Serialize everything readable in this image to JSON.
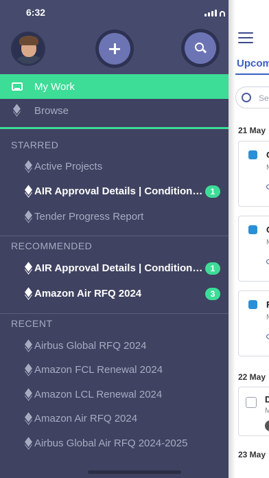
{
  "status_bar": {
    "time": "6:32"
  },
  "header": {
    "avatar_icon": "user-avatar",
    "add_icon": "plus-icon",
    "search_icon": "search-icon"
  },
  "nav": {
    "my_work": "My Work",
    "browse": "Browse"
  },
  "sections": {
    "starred": {
      "title": "STARRED",
      "items": [
        {
          "label": "Active Projects",
          "bold": false,
          "badge": null
        },
        {
          "label": "AIR Approval Details | Condition Check",
          "bold": true,
          "badge": "1"
        },
        {
          "label": "Tender Progress Report",
          "bold": false,
          "badge": null
        }
      ]
    },
    "recommended": {
      "title": "RECOMMENDED",
      "items": [
        {
          "label": "AIR Approval Details | Condition Check",
          "bold": true,
          "badge": "1"
        },
        {
          "label": "Amazon Air RFQ 2024",
          "bold": true,
          "badge": "3"
        }
      ]
    },
    "recent": {
      "title": "RECENT",
      "items": [
        {
          "label": "Airbus Global RFQ 2024"
        },
        {
          "label": "Amazon FCL Renewal 2024"
        },
        {
          "label": "Amazon LCL Renewal 2024"
        },
        {
          "label": "Amazon Air RFQ 2024"
        },
        {
          "label": "Airbus Global Air RFQ 2024-2025"
        }
      ]
    }
  },
  "main_panel": {
    "tab_label": "Upcoming",
    "search_placeholder": "Search",
    "dates": [
      "21 May",
      "22 May",
      "23 May"
    ],
    "card_letters": [
      "C",
      "C",
      "F",
      "D"
    ],
    "card_sub": "M"
  },
  "colors": {
    "drawer_bg": "#3f4260",
    "accent": "#3ddc97",
    "button_fill": "#6d74b4",
    "link_blue": "#3b5fc0"
  }
}
